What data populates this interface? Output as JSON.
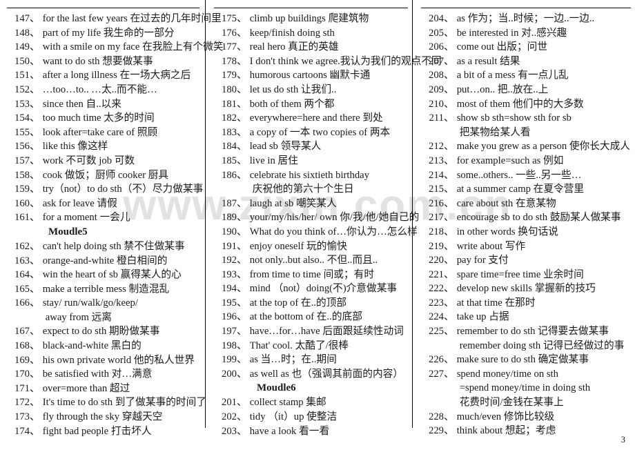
{
  "document": {
    "watermark": "www.zixin.com.cn",
    "page_number": "3"
  },
  "columns": [
    {
      "id": "column-1",
      "lines": [
        {
          "type": "entry",
          "num": "147",
          "text": "for the last few years    在过去的几年时间里"
        },
        {
          "type": "entry",
          "num": "148",
          "text": "part of my life    我生命的一部分"
        },
        {
          "type": "entry",
          "num": "149",
          "text": "with a smile on my face 在我脸上有个微笑"
        },
        {
          "type": "entry",
          "num": "150",
          "text": "want to do sth  想要做某事"
        },
        {
          "type": "entry",
          "num": "151",
          "text": "after a long illness   在一场大病之后"
        },
        {
          "type": "entry",
          "num": "152",
          "text": "…too…to..    …太..而不能…"
        },
        {
          "type": "entry",
          "num": "153",
          "text": "since then  自..以来"
        },
        {
          "type": "entry",
          "num": "154",
          "text": "too much time    太多的时间"
        },
        {
          "type": "entry",
          "num": "155",
          "text": "look after=take care of  照顾"
        },
        {
          "type": "entry",
          "num": "156",
          "text": "like this     像这样"
        },
        {
          "type": "entry",
          "num": "157",
          "text": "work  不可数    job  可数"
        },
        {
          "type": "entry",
          "num": "158",
          "text": "cook 做饭；厨师  cooker  厨具"
        },
        {
          "type": "entry",
          "num": "159",
          "text": "try（not）to do sth（不）尽力做某事"
        },
        {
          "type": "entry",
          "num": "160",
          "text": "ask for leave    请假"
        },
        {
          "type": "entry",
          "num": "161",
          "text": "for a moment    一会儿"
        },
        {
          "type": "module",
          "text": "Moudle5"
        },
        {
          "type": "entry",
          "num": "162",
          "text": "can't help doing sth 禁不住做某事"
        },
        {
          "type": "entry",
          "num": "163",
          "text": "orange-and-white 橙白相间的"
        },
        {
          "type": "entry",
          "num": "164",
          "text": "win the heart of sb  赢得某人的心"
        },
        {
          "type": "entry",
          "num": "165",
          "text": "make a terrible mess  制造混乱"
        },
        {
          "type": "entry",
          "num": "166",
          "text": "stay/ run/walk/go/keep/"
        },
        {
          "type": "cont",
          "text": "away from    远离"
        },
        {
          "type": "entry",
          "num": "167",
          "text": "expect to do sth  期盼做某事"
        },
        {
          "type": "entry",
          "num": "168",
          "text": "black-and-white    黑白的"
        },
        {
          "type": "entry",
          "num": "169",
          "text": "his own private world  他的私人世界"
        },
        {
          "type": "entry",
          "num": "170",
          "text": "be satisfied with    对…满意"
        },
        {
          "type": "entry",
          "num": "171",
          "text": "over=more than  超过"
        },
        {
          "type": "entry",
          "num": "172",
          "text": "It's time to do sth  到了做某事的时间了"
        },
        {
          "type": "entry",
          "num": "173",
          "text": "fly through the sky  穿越天空"
        },
        {
          "type": "entry",
          "num": "174",
          "text": "fight bad people  打击坏人"
        }
      ]
    },
    {
      "id": "column-2",
      "lines": [
        {
          "type": "entry",
          "num": "175",
          "text": "climb up buildings  爬建筑物"
        },
        {
          "type": "entry",
          "num": "176",
          "text": "keep/finish doing sth"
        },
        {
          "type": "entry",
          "num": "177",
          "text": "real hero    真正的英雄"
        },
        {
          "type": "entry",
          "num": "178",
          "text": "I don't think we agree.我认为我们的观点不同"
        },
        {
          "type": "entry",
          "num": "179",
          "text": "humorous cartoons  幽默卡通"
        },
        {
          "type": "entry",
          "num": "180",
          "text": "let us do sth 让我们.."
        },
        {
          "type": "entry",
          "num": "181",
          "text": "both of them    两个都"
        },
        {
          "type": "entry",
          "num": "182",
          "text": "everywhere=here and there 到处"
        },
        {
          "type": "entry",
          "num": "183",
          "text": "a copy of  一本 two copies of 两本"
        },
        {
          "type": "entry",
          "num": "184",
          "text": "lead sb    领导某人"
        },
        {
          "type": "entry",
          "num": "185",
          "text": "live in    居住"
        },
        {
          "type": "entry",
          "num": "186",
          "text": "celebrate his sixtieth birthday"
        },
        {
          "type": "cont",
          "text": "庆祝他的第六十个生日"
        },
        {
          "type": "entry",
          "num": "187",
          "text": "laugh at sb   嘲笑某人"
        },
        {
          "type": "entry",
          "num": "189",
          "text": "your/my/his/her/ own 你/我/他/她自己的"
        },
        {
          "type": "entry",
          "num": "190",
          "text": "What do you think of…你认为…怎么样"
        },
        {
          "type": "entry",
          "num": "191",
          "text": "enjoy oneself 玩的愉快"
        },
        {
          "type": "entry",
          "num": "192",
          "text": "not only..but also..   不但..而且.."
        },
        {
          "type": "entry",
          "num": "193",
          "text": "from time to time    间或；有时"
        },
        {
          "type": "entry",
          "num": "194",
          "text": "mind （not）doing(不)介意做某事"
        },
        {
          "type": "entry",
          "num": "195",
          "text": "at the top of    在..的顶部"
        },
        {
          "type": "entry",
          "num": "196",
          "text": "at the bottom of    在..的底部"
        },
        {
          "type": "entry",
          "num": "197",
          "text": "have…for…have 后面跟延续性动词"
        },
        {
          "type": "entry",
          "num": "198",
          "text": "That' cool.   太酷了/很棒"
        },
        {
          "type": "entry",
          "num": "199",
          "text": "as    当…时；在..期间"
        },
        {
          "type": "entry",
          "num": "200",
          "text": "as well as 也（强调其前面的内容）"
        },
        {
          "type": "module",
          "text": "Moudle6"
        },
        {
          "type": "entry",
          "num": "201",
          "text": "collect stamp  集邮"
        },
        {
          "type": "entry",
          "num": "202",
          "text": "tidy （it）up 使整洁"
        },
        {
          "type": "entry",
          "num": "203",
          "text": "have a look    看一看"
        }
      ]
    },
    {
      "id": "column-3",
      "lines": [
        {
          "type": "entry",
          "num": "204",
          "text": "as 作为；当..时候；一边..一边.."
        },
        {
          "type": "entry",
          "num": "205",
          "text": "be interested in   对..感兴趣"
        },
        {
          "type": "entry",
          "num": "206",
          "text": "come out    出版；问世"
        },
        {
          "type": "entry",
          "num": "207",
          "text": "as a result   结果"
        },
        {
          "type": "entry",
          "num": "208",
          "text": "a bit of a mess 有一点儿乱"
        },
        {
          "type": "entry",
          "num": "209",
          "text": "put…on..   把..放在..上"
        },
        {
          "type": "entry",
          "num": "210",
          "text": "most of them   他们中的大多数"
        },
        {
          "type": "entry",
          "num": "211",
          "text": "show sb sth=show sth for sb"
        },
        {
          "type": "cont",
          "text": "把某物给某人看"
        },
        {
          "type": "entry",
          "num": "212",
          "text": "make you grew as a person 使你长大成人"
        },
        {
          "type": "entry",
          "num": "213",
          "text": "for example=such as    例如"
        },
        {
          "type": "entry",
          "num": "214",
          "text": "some..others..    一些..另一些…"
        },
        {
          "type": "entry",
          "num": "215",
          "text": "at a summer camp  在夏令营里"
        },
        {
          "type": "entry",
          "num": "216",
          "text": "care about sth    在意某物"
        },
        {
          "type": "entry",
          "num": "217",
          "text": "encourage sb to do sth  鼓励某人做某事"
        },
        {
          "type": "entry",
          "num": "218",
          "text": "in other words  换句话说"
        },
        {
          "type": "entry",
          "num": "219",
          "text": "write about  写作"
        },
        {
          "type": "entry",
          "num": "220",
          "text": "pay for   支付"
        },
        {
          "type": "entry",
          "num": "221",
          "text": "spare time=free time  业余时间"
        },
        {
          "type": "entry",
          "num": "222",
          "text": "develop new skills  掌握新的技巧"
        },
        {
          "type": "entry",
          "num": "223",
          "text": "at that time    在那时"
        },
        {
          "type": "entry",
          "num": "224",
          "text": "take up    占据"
        },
        {
          "type": "entry",
          "num": "225",
          "text": "remember to do sth 记得要去做某事"
        },
        {
          "type": "cont",
          "text": "remember doing sth  记得已经做过的事"
        },
        {
          "type": "entry",
          "num": "226",
          "text": "make sure to do sth  确定做某事"
        },
        {
          "type": "entry",
          "num": "227",
          "text": "spend money/time on sth"
        },
        {
          "type": "cont",
          "text": "=spend money/time in doing sth"
        },
        {
          "type": "cont",
          "text": "花费时间/金钱在某事上"
        },
        {
          "type": "entry",
          "num": "228",
          "text": "much/even  修饰比较级"
        },
        {
          "type": "entry",
          "num": "229",
          "text": "think about  想起；考虑"
        }
      ]
    }
  ],
  "separator": "、"
}
